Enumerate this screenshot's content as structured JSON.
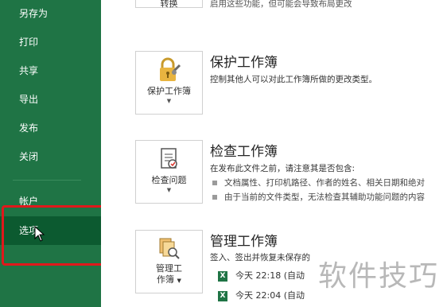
{
  "sidebar": {
    "items": [
      {
        "label": "另存为"
      },
      {
        "label": "打印"
      },
      {
        "label": "共享"
      },
      {
        "label": "导出"
      },
      {
        "label": "发布"
      },
      {
        "label": "关闭"
      },
      {
        "label": "帐户"
      },
      {
        "label": "选项"
      }
    ]
  },
  "main": {
    "top_tile_label": "转换",
    "top_desc": "启用这些功能，但可能会导致布局更改",
    "protect": {
      "title": "保护工作簿",
      "desc": "控制其他人可以对此工作簿所做的更改类型。",
      "tile_label": "保护工作簿"
    },
    "inspect": {
      "title": "检查工作簿",
      "desc": "在发布此文件之前，请注意其是否包含:",
      "bullets": [
        "文档属性、打印机路径、作者的姓名、相关日期和绝对",
        "由于当前的文件类型，无法检查其辅助功能问题的内容"
      ],
      "tile_label": "检查问题"
    },
    "manage": {
      "title": "管理工作簿",
      "desc": "签入、签出并恢复未保存的",
      "tile_label_1": "管理工",
      "tile_label_2": "作簿",
      "versions": [
        "今天 22:18 (自动",
        "今天 22:04 (自动"
      ]
    }
  },
  "watermark": "软件技巧",
  "colors": {
    "sidebar_bg": "#1f7445",
    "selected_bg": "#0c5a30",
    "highlight_border": "#e0181b"
  }
}
